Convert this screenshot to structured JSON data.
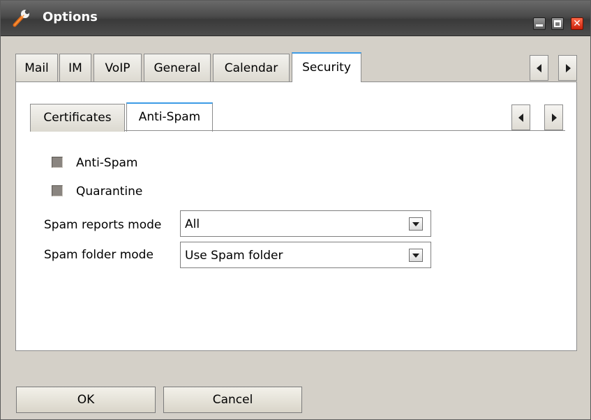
{
  "window": {
    "title": "Options",
    "icon": "wrench-icon"
  },
  "outer_tabs": [
    {
      "label": "Mail"
    },
    {
      "label": "IM"
    },
    {
      "label": "VoIP"
    },
    {
      "label": "General"
    },
    {
      "label": "Calendar"
    },
    {
      "label": "Security",
      "active": true
    }
  ],
  "inner_tabs": [
    {
      "label": "Certificates"
    },
    {
      "label": "Anti-Spam",
      "active": true
    }
  ],
  "anti_spam": {
    "antispam_label": "Anti-Spam",
    "antispam_checked": false,
    "quarantine_label": "Quarantine",
    "quarantine_checked": false,
    "reports_mode_label": "Spam reports mode",
    "reports_mode_value": "All",
    "folder_mode_label": "Spam folder mode",
    "folder_mode_value": "Use Spam folder"
  },
  "buttons": {
    "ok": "OK",
    "cancel": "Cancel"
  },
  "colors": {
    "active_tab_accent": "#3c9be6",
    "close_button": "#e0401e",
    "titlebar": "#4a4a4a"
  }
}
